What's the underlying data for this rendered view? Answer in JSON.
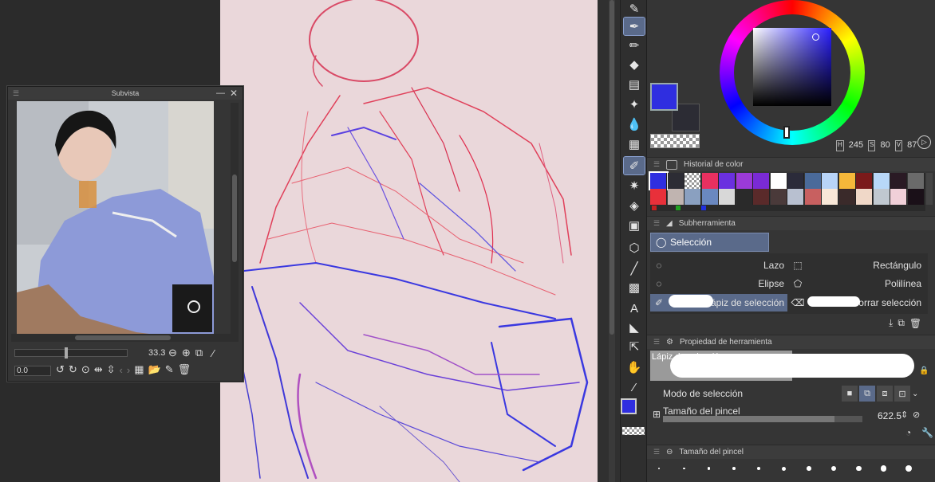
{
  "subview": {
    "title": "Subvista",
    "zoom_value": "33.3",
    "rotation_value": "0.0"
  },
  "color": {
    "main_hex": "#2f2ee0",
    "sub_hex": "#2c2c34",
    "h": "245",
    "s": "80",
    "v": "87",
    "h_label": "H",
    "s_label": "S",
    "v_label": "V"
  },
  "color_history": {
    "title": "Historial de color",
    "row1": [
      "#2f2ee0",
      "#2c2c34",
      "checker",
      "#e83060",
      "#6a30e0",
      "#9b3ad8",
      "#7a2ad6",
      "#ffffff",
      "#2b2b3a",
      "#4a6a9a",
      "#b8d4f8",
      "#f5b83a",
      "#7a1a1a",
      "#b8d8f8",
      "#2a1a24",
      "#6a6a6a"
    ],
    "row2": [
      "#e8303a",
      "#c0b4b0",
      "#8aa0c0",
      "#6a88c0",
      "#d8d8d8",
      "#2a2a2a",
      "#5a2a2a",
      "#4a3a3a",
      "#b8c0d0",
      "#c86060",
      "#f8e8d8",
      "#3a2a2a",
      "#f0d8c8",
      "#c0c8d0",
      "#f0d0d8",
      "#1a1018"
    ]
  },
  "subtool": {
    "panel_title": "Subherramienta",
    "tab_label": "Selección",
    "items": [
      {
        "label": "Lazo",
        "icon": "lasso-icon"
      },
      {
        "label": "Rectángulo",
        "icon": "rectangle-select-icon"
      },
      {
        "label": "Elipse",
        "icon": "ellipse-select-icon"
      },
      {
        "label": "Polilínea",
        "icon": "polyline-select-icon"
      },
      {
        "label": "Lápiz de selección",
        "icon": "selection-pen-icon"
      },
      {
        "label": "Borrar selección",
        "icon": "erase-selection-icon"
      }
    ]
  },
  "tool_property": {
    "panel_title": "Propiedad de herramienta",
    "tool_name": "Lápiz de selección",
    "selection_mode_label": "Modo de selección",
    "brush_size_label": "Tamaño del pincel",
    "brush_size_value": "622.5"
  },
  "brush_size_panel": {
    "title": "Tamaño del pincel"
  }
}
